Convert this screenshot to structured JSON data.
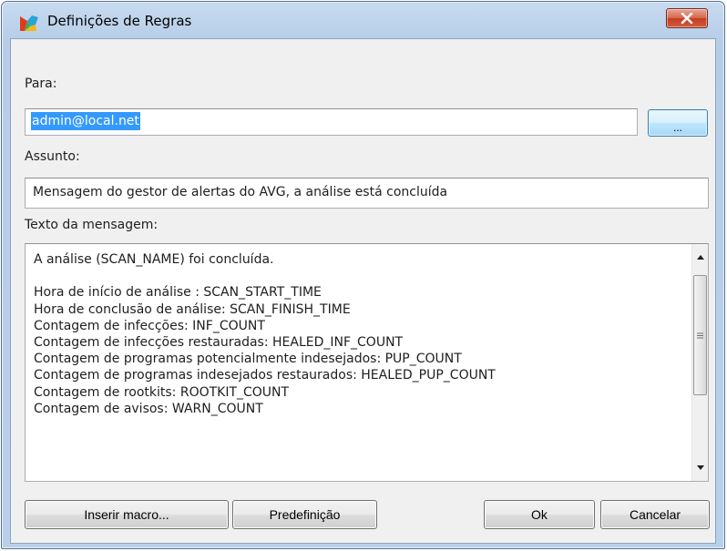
{
  "window": {
    "title": "Definições de Regras",
    "close_icon": "close-x-icon",
    "app_icon": "avg-logo-icon"
  },
  "form": {
    "to_label": "Para:",
    "to_value": "admin@local.net",
    "browse_label": "...",
    "subject_label": "Assunto:",
    "subject_value": "Mensagem do gestor de alertas do AVG, a análise está concluída",
    "message_label": "Texto da mensagem:",
    "message_lines": [
      "A análise (SCAN_NAME) foi concluída.",
      "",
      "Hora de início de análise : SCAN_START_TIME",
      "Hora de conclusão de análise: SCAN_FINISH_TIME",
      "Contagem de infecções: INF_COUNT",
      "Contagem de infecções restauradas: HEALED_INF_COUNT",
      "Contagem de programas potencialmente indesejados: PUP_COUNT",
      "Contagem de programas indesejados restaurados: HEALED_PUP_COUNT",
      "Contagem de rootkits: ROOTKIT_COUNT",
      "Contagem de avisos: WARN_COUNT"
    ]
  },
  "buttons": {
    "insert_macro": "Inserir macro...",
    "default": "Predefinição",
    "ok": "Ok",
    "cancel": "Cancelar"
  },
  "colors": {
    "selection": "#3399ff",
    "close_button": "#c94a2e",
    "frame": "#b9d0ea"
  }
}
